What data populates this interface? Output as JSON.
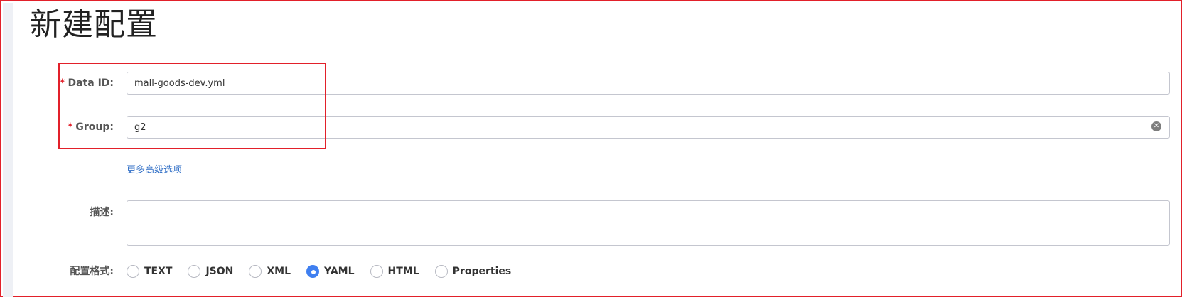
{
  "page": {
    "title": "新建配置"
  },
  "form": {
    "data_id": {
      "required_mark": "*",
      "label": "Data ID:",
      "value": "mall-goods-dev.yml"
    },
    "group": {
      "required_mark": "*",
      "label": "Group:",
      "value": "g2"
    },
    "advanced_link": "更多高级选项",
    "description": {
      "label": "描述:",
      "value": ""
    },
    "format": {
      "label": "配置格式:",
      "options": [
        "TEXT",
        "JSON",
        "XML",
        "YAML",
        "HTML",
        "Properties"
      ],
      "selected": "YAML"
    }
  },
  "colors": {
    "highlight": "#e2202a",
    "accent": "#3f7ff0",
    "link": "#2f6ec6"
  }
}
